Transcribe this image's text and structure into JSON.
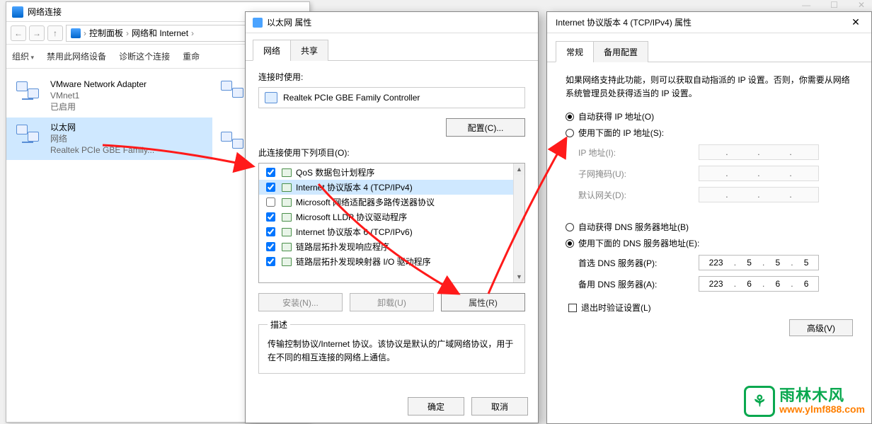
{
  "topicons": {
    "min": "—",
    "max": "☐",
    "close": "✕"
  },
  "win1": {
    "title": "网络连接",
    "crumb": {
      "a": "控制面板",
      "b": "网络和 Internet",
      "sep": "›"
    },
    "toolbar": {
      "org": "组织",
      "disable": "禁用此网络设备",
      "diag": "诊断这个连接",
      "rename": "重命"
    },
    "items": [
      {
        "l1": "VMware Network Adapter",
        "l2": "VMnet1",
        "l3": "已启用"
      },
      {
        "l1": "以太网",
        "l2": "网络",
        "l3": "Realtek PCIe GBE Family..."
      }
    ]
  },
  "dlg2": {
    "title": "以太网 属性",
    "tabs": {
      "net": "网络",
      "share": "共享"
    },
    "connectLabel": "连接时使用:",
    "device": "Realtek PCIe GBE Family Controller",
    "configBtn": "配置(C)...",
    "listLabel": "此连接使用下列项目(O):",
    "items": [
      {
        "chk": true,
        "label": "QoS 数据包计划程序"
      },
      {
        "chk": true,
        "label": "Internet 协议版本 4 (TCP/IPv4)",
        "sel": true
      },
      {
        "chk": false,
        "label": "Microsoft 网络适配器多路传送器协议"
      },
      {
        "chk": true,
        "label": "Microsoft LLDP 协议驱动程序"
      },
      {
        "chk": true,
        "label": "Internet 协议版本 6 (TCP/IPv6)"
      },
      {
        "chk": true,
        "label": "链路层拓扑发现响应程序"
      },
      {
        "chk": true,
        "label": "链路层拓扑发现映射器 I/O 驱动程序"
      }
    ],
    "install": "安装(N)...",
    "uninstall": "卸载(U)",
    "prop": "属性(R)",
    "descLegend": "描述",
    "descText": "传输控制协议/Internet 协议。该协议是默认的广域网络协议，用于在不同的相互连接的网络上通信。",
    "ok": "确定",
    "cancel": "取消"
  },
  "dlg3": {
    "title": "Internet 协议版本 4 (TCP/IPv4) 属性",
    "close": "✕",
    "tabs": {
      "gen": "常规",
      "alt": "备用配置"
    },
    "info": "如果网络支持此功能，则可以获取自动指派的 IP 设置。否则，你需要从网络系统管理员处获得适当的 IP 设置。",
    "r1": "自动获得 IP 地址(O)",
    "r2": "使用下面的 IP 地址(S):",
    "ipL": "IP 地址(I):",
    "maskL": "子网掩码(U):",
    "gwL": "默认网关(D):",
    "r3": "自动获得 DNS 服务器地址(B)",
    "r4": "使用下面的 DNS 服务器地址(E):",
    "dns1L": "首选 DNS 服务器(P):",
    "dns2L": "备用 DNS 服务器(A):",
    "dns1": {
      "a": "223",
      "b": "5",
      "c": "5",
      "d": "5"
    },
    "dns2": {
      "a": "223",
      "b": "6",
      "c": "6",
      "d": "6"
    },
    "chk": "退出时验证设置(L)",
    "adv": "高级(V)"
  },
  "wm": {
    "logo": "⚘",
    "t1": "雨林木风",
    "t2": "www.ylmf888.com"
  }
}
